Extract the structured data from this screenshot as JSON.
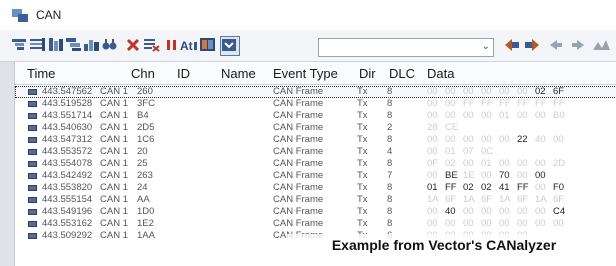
{
  "window": {
    "title": "CAN"
  },
  "toolbar": {
    "icons": [
      "filter-icon",
      "list-icon",
      "columns-icon",
      "tree-icon",
      "chart-icon",
      "find-icon",
      "delete-icon",
      "clear-icon",
      "pause-icon",
      "time-icon",
      "layout-icon",
      "snapshot-icon"
    ],
    "filter_value": "",
    "nav_icons": [
      "mark-prev-icon",
      "mark-next-icon",
      "back-icon",
      "forward-icon",
      "skip-icon"
    ]
  },
  "grid": {
    "columns": [
      "Time",
      "Chn",
      "ID",
      "Name",
      "Event Type",
      "Dir",
      "DLC",
      "Data"
    ],
    "rows": [
      {
        "time": "443.547562",
        "chn": "CAN 1",
        "id": "260",
        "type": "CAN Frame",
        "dir": "Tx",
        "dlc": "8",
        "data": [
          "00",
          "00",
          "00",
          "00",
          "00",
          "00",
          "02",
          "6F"
        ],
        "strong": [
          6,
          7
        ],
        "selected": true
      },
      {
        "time": "443.519528",
        "chn": "CAN 1",
        "id": "3FC",
        "type": "CAN Frame",
        "dir": "Tx",
        "dlc": "8",
        "data": [
          "00",
          "00",
          "FF",
          "FF",
          "FF",
          "FF",
          "FF",
          "FF"
        ],
        "strong": []
      },
      {
        "time": "443.551714",
        "chn": "CAN 1",
        "id": "B4",
        "type": "CAN Frame",
        "dir": "Tx",
        "dlc": "8",
        "data": [
          "00",
          "00",
          "00",
          "00",
          "01",
          "00",
          "00",
          "B0"
        ],
        "strong": []
      },
      {
        "time": "443.540630",
        "chn": "CAN 1",
        "id": "2D5",
        "type": "CAN Frame",
        "dir": "Tx",
        "dlc": "2",
        "data": [
          "28",
          "CE"
        ],
        "strong": []
      },
      {
        "time": "443.547312",
        "chn": "CAN 1",
        "id": "1C6",
        "type": "CAN Frame",
        "dir": "Tx",
        "dlc": "8",
        "data": [
          "00",
          "00",
          "00",
          "00",
          "00",
          "22",
          "40",
          "00"
        ],
        "strong": [
          5
        ]
      },
      {
        "time": "443.553572",
        "chn": "CAN 1",
        "id": "20",
        "type": "CAN Frame",
        "dir": "Tx",
        "dlc": "4",
        "data": [
          "00",
          "01",
          "07",
          "0C"
        ],
        "strong": []
      },
      {
        "time": "443.554078",
        "chn": "CAN 1",
        "id": "25",
        "type": "CAN Frame",
        "dir": "Tx",
        "dlc": "8",
        "data": [
          "0F",
          "02",
          "00",
          "01",
          "00",
          "00",
          "00",
          "2D"
        ],
        "strong": []
      },
      {
        "time": "443.542492",
        "chn": "CAN 1",
        "id": "263",
        "type": "CAN Frame",
        "dir": "Tx",
        "dlc": "7",
        "data": [
          "00",
          "BE",
          "1E",
          "00",
          "70",
          "00",
          "00"
        ],
        "strong": [
          1,
          4,
          6
        ]
      },
      {
        "time": "443.553820",
        "chn": "CAN 1",
        "id": "24",
        "type": "CAN Frame",
        "dir": "Tx",
        "dlc": "8",
        "data": [
          "01",
          "FF",
          "02",
          "02",
          "41",
          "FF",
          "00",
          "F0"
        ],
        "strong": [
          0,
          1,
          2,
          3,
          4,
          5,
          7
        ]
      },
      {
        "time": "443.555154",
        "chn": "CAN 1",
        "id": "AA",
        "type": "CAN Frame",
        "dir": "Tx",
        "dlc": "8",
        "data": [
          "1A",
          "6F",
          "1A",
          "6F",
          "1A",
          "6F",
          "1A",
          "6F"
        ],
        "strong": []
      },
      {
        "time": "443.549196",
        "chn": "CAN 1",
        "id": "1D0",
        "type": "CAN Frame",
        "dir": "Tx",
        "dlc": "8",
        "data": [
          "00",
          "40",
          "00",
          "00",
          "00",
          "00",
          "00",
          "C4"
        ],
        "strong": [
          1,
          7
        ]
      },
      {
        "time": "443.553162",
        "chn": "CAN 1",
        "id": "1E2",
        "type": "CAN Frame",
        "dir": "Tx",
        "dlc": "8",
        "data": [
          "00",
          "00",
          "00",
          "00",
          "00",
          "00",
          "00",
          "00"
        ],
        "strong": []
      },
      {
        "time": "443.509292",
        "chn": "CAN 1",
        "id": "1AA",
        "type": "CAN Frame",
        "dir": "Tx",
        "dlc": "6",
        "data": [
          "00",
          "00",
          "00",
          "00",
          "00",
          "00"
        ],
        "strong": []
      }
    ]
  },
  "caption": "Example from Vector's CANalyzer"
}
